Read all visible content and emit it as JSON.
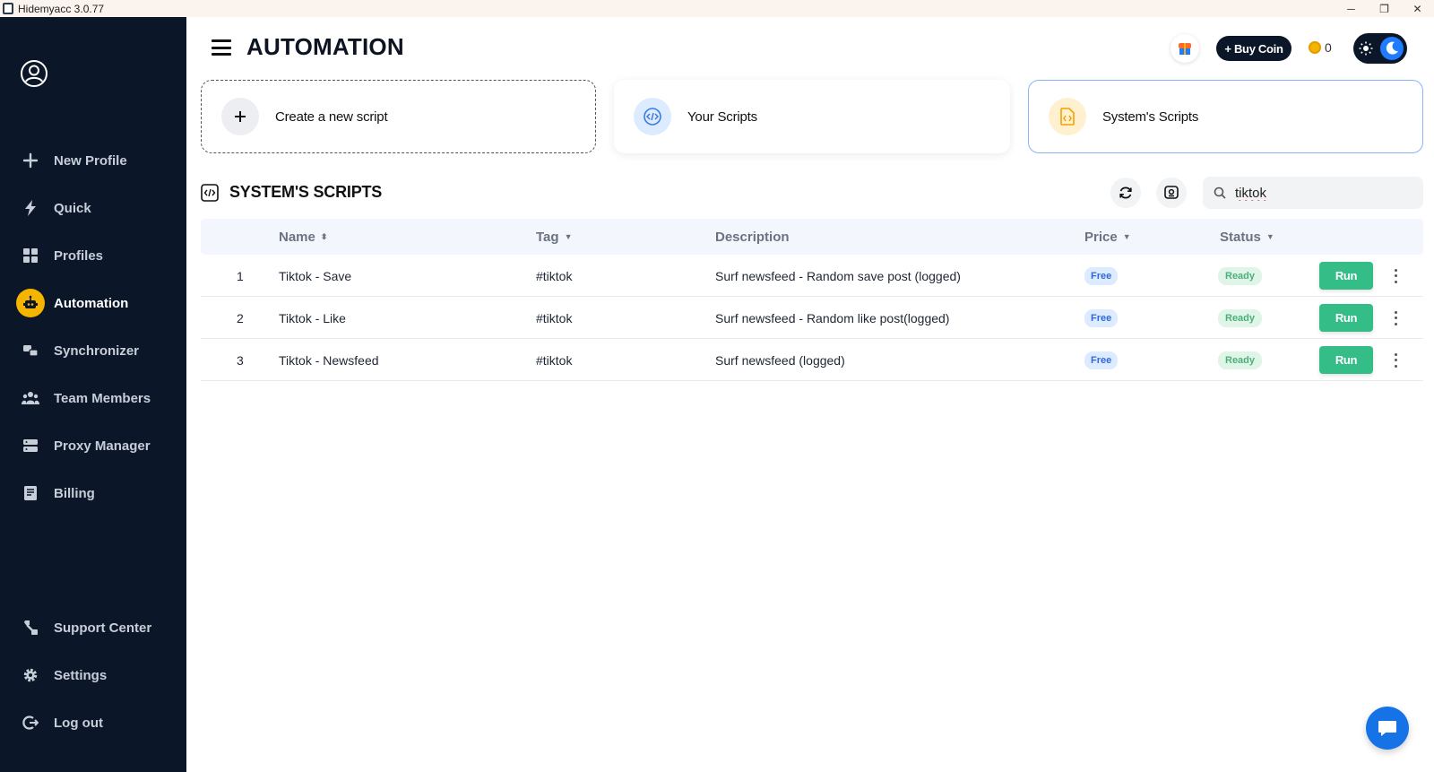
{
  "window": {
    "title": "Hidemyacc 3.0.77",
    "minimize": "─",
    "restore": "❐",
    "close": "✕"
  },
  "sidebar": {
    "items": [
      {
        "label": "New Profile",
        "icon": "plus-icon"
      },
      {
        "label": "Quick",
        "icon": "lightning-icon"
      },
      {
        "label": "Profiles",
        "icon": "grid-icon"
      },
      {
        "label": "Automation",
        "icon": "robot-icon",
        "active": true
      },
      {
        "label": "Synchronizer",
        "icon": "sync-icon"
      },
      {
        "label": "Team Members",
        "icon": "team-icon"
      },
      {
        "label": "Proxy Manager",
        "icon": "server-icon"
      },
      {
        "label": "Billing",
        "icon": "billing-icon"
      }
    ],
    "bottom_items": [
      {
        "label": "Support Center",
        "icon": "support-icon"
      },
      {
        "label": "Settings",
        "icon": "gear-icon"
      },
      {
        "label": "Log out",
        "icon": "logout-icon"
      }
    ]
  },
  "header": {
    "title": "AUTOMATION",
    "buy_coin": "+ Buy Coin",
    "coin_balance": "0"
  },
  "cards": {
    "create": "Create a new script",
    "yours": "Your Scripts",
    "system": "System's Scripts"
  },
  "section": {
    "title": "SYSTEM'S SCRIPTS",
    "search_value": "tiktok"
  },
  "table": {
    "columns": {
      "name": "Name",
      "tag": "Tag",
      "description": "Description",
      "price": "Price",
      "status": "Status"
    },
    "rows": [
      {
        "index": "1",
        "name": "Tiktok - Save",
        "tag": "#tiktok",
        "description": "Surf newsfeed - Random save post (logged)",
        "price": "Free",
        "status": "Ready",
        "action": "Run"
      },
      {
        "index": "2",
        "name": "Tiktok - Like",
        "tag": "#tiktok",
        "description": "Surf newsfeed - Random like post(logged)",
        "price": "Free",
        "status": "Ready",
        "action": "Run"
      },
      {
        "index": "3",
        "name": "Tiktok - Newsfeed",
        "tag": "#tiktok",
        "description": "Surf newsfeed (logged)",
        "price": "Free",
        "status": "Ready",
        "action": "Run"
      }
    ]
  },
  "colors": {
    "sidebar_bg": "#0b1729",
    "active_accent": "#f4b400",
    "run_button": "#35bd87",
    "chat_button": "#1673e6"
  }
}
